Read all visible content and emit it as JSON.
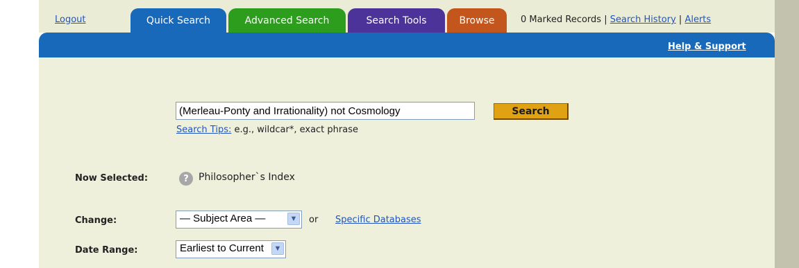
{
  "nav": {
    "logout": "Logout",
    "tabs": [
      {
        "label": "Quick Search",
        "color": "#1869b9"
      },
      {
        "label": "Advanced Search",
        "color": "#2d9d1d"
      },
      {
        "label": "Search Tools",
        "color": "#4b3399"
      },
      {
        "label": "Browse",
        "color": "#c3561c"
      }
    ],
    "marked_records": "0 Marked Records |",
    "search_history": "Search History",
    "separator": "|",
    "alerts": "Alerts"
  },
  "header": {
    "help_support": "Help & Support"
  },
  "search": {
    "query": "(Merleau-Ponty and Irrationality) not Cosmology",
    "button_label": "Search",
    "tips_link": "Search Tips:",
    "tips_text": " e.g., wildcar*, exact phrase"
  },
  "selection": {
    "now_selected_label": "Now Selected:",
    "now_selected_value": "Philosopher`s Index",
    "change_label": "Change:",
    "subject_area_value": "— Subject Area —",
    "or_text": "or",
    "specific_databases": "Specific Databases",
    "date_range_label": "Date Range:",
    "date_range_value": "Earliest to Current"
  },
  "icons": {
    "help": "question-circle-icon",
    "dropdown": "chevron-down-icon"
  },
  "colors": {
    "blue_bar": "#1869b9",
    "panel_bg": "#eef0db",
    "search_button": "#e0a112",
    "link": "#2255bb"
  }
}
